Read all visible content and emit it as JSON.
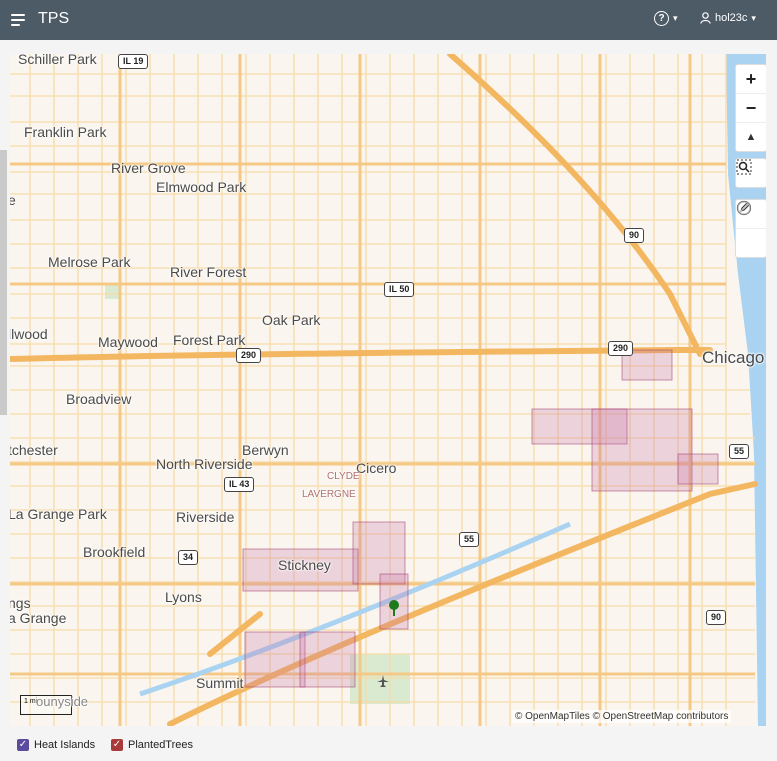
{
  "header": {
    "title": "TPS",
    "username": "hol23c",
    "help_glyph": "?",
    "chevron": "▾"
  },
  "map": {
    "labels": {
      "schiller_park": "Schiller Park",
      "franklin_park": "Franklin Park",
      "river_grove": "River Grove",
      "elmwood_park": "Elmwood Park",
      "melrose_park": "Melrose Park",
      "river_forest": "River Forest",
      "oak_park": "Oak Park",
      "maywood": "Maywood",
      "forest_park": "Forest Park",
      "broadview": "Broadview",
      "westchester": "tchester",
      "berwyn": "Berwyn",
      "north_riverside": "North Riverside",
      "cicero": "Cicero",
      "clyde": "CLYDE",
      "lavergne": "LAVERGNE",
      "la_grange_park": "La Grange Park",
      "riverside": "Riverside",
      "brookfield": "Brookfield",
      "stickney": "Stickney",
      "lyons": "Lyons",
      "la_grange_ings": "ngs",
      "la_grange": "a Grange",
      "summit": "Summit",
      "chicago": "Chicago",
      "bellwood": "llwood",
      "edge_e": "e"
    },
    "shields": {
      "il19": "IL 19",
      "il50": "IL 50",
      "il43": "IL 43",
      "i290a": "290",
      "i290b": "290",
      "i90a": "90",
      "i90b": "90",
      "i55a": "55",
      "i55b": "55",
      "us34": "34"
    },
    "controls": {
      "zoom_in": "+",
      "zoom_out": "−",
      "north": "▲"
    },
    "scale": "1 mi",
    "scale_overlay": "ounyside",
    "attribution": "© OpenMapTiles  © OpenStreetMap contributors"
  },
  "legend": [
    {
      "label": "Heat Islands",
      "color": "#5b4a9e",
      "checked": true
    },
    {
      "label": "PlantedTrees",
      "color": "#a83a3a",
      "checked": true
    }
  ]
}
